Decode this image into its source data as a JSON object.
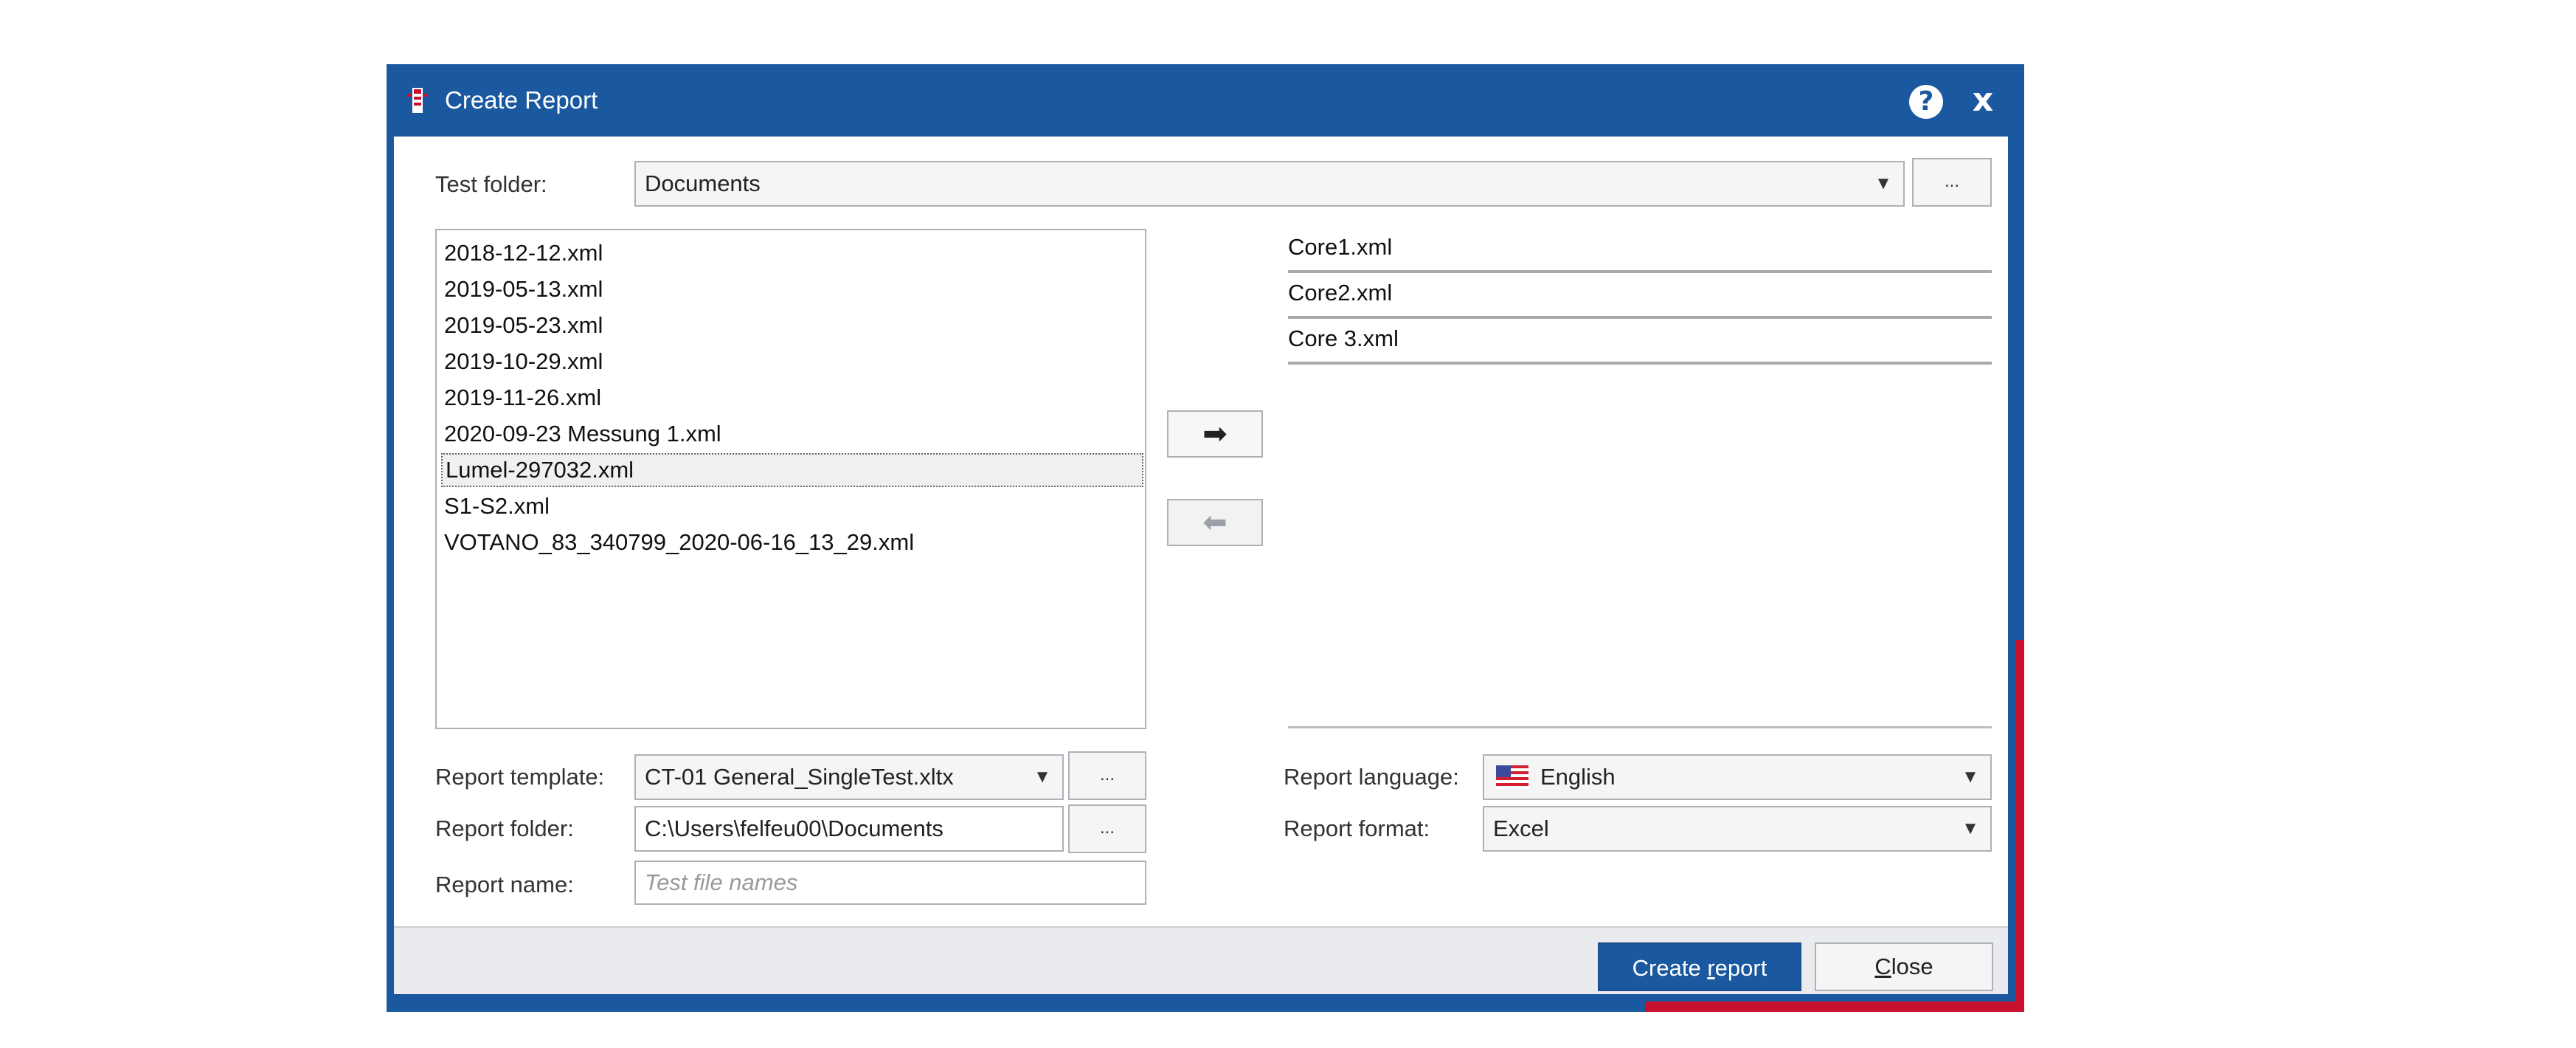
{
  "window": {
    "title": "Create Report",
    "help_glyph": "?",
    "close_glyph": "x"
  },
  "test_folder": {
    "label": "Test folder:",
    "value": "Documents",
    "browse": "..."
  },
  "available_files": {
    "items": [
      "2018-12-12.xml",
      "2019-05-13.xml",
      "2019-05-23.xml",
      "2019-10-29.xml",
      "2019-11-26.xml",
      "2020-09-23 Messung 1.xml",
      "Lumel-297032.xml",
      "S1-S2.xml",
      "VOTANO_83_340799_2020-06-16_13_29.xml"
    ],
    "selected": "Lumel-297032.xml"
  },
  "transfer": {
    "add_icon": "arrow-right-icon",
    "remove_icon": "arrow-left-icon"
  },
  "selected_files": {
    "items": [
      "Core1.xml",
      "Core2.xml",
      "Core 3.xml"
    ]
  },
  "report_template": {
    "label": "Report template:",
    "value": "CT-01 General_SingleTest.xltx",
    "browse": "..."
  },
  "report_folder": {
    "label": "Report folder:",
    "value": "C:\\Users\\felfeu00\\Documents",
    "browse": "..."
  },
  "report_name": {
    "label": "Report name:",
    "placeholder": "Test file names"
  },
  "report_language": {
    "label": "Report language:",
    "value": "English",
    "flag_icon": "us-flag-icon"
  },
  "report_format": {
    "label": "Report format:",
    "value": "Excel"
  },
  "footer": {
    "create_prefix": "Create ",
    "create_mnemonic": "r",
    "create_suffix": "eport",
    "close_mnemonic": "C",
    "close_suffix": "lose"
  },
  "colors": {
    "title_bar": "#1a589f",
    "accent_red": "#c8102e",
    "primary_button": "#1a589f"
  }
}
